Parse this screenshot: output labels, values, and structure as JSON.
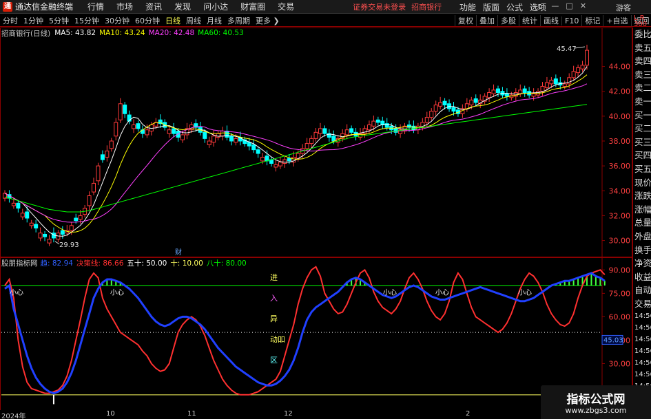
{
  "app": {
    "title": "通达信金融终端",
    "logo_glyph": "通",
    "menus": [
      "行情",
      "市场",
      "资讯",
      "发现",
      "问小达",
      "财富圈",
      "交易"
    ],
    "warning": "证券交易未登录",
    "stock_link": "招商银行",
    "right_menus": [
      "功能",
      "版面",
      "公式",
      "选项"
    ],
    "window_controls": [
      "▭",
      "—",
      "□",
      "✕"
    ],
    "guest": "游客"
  },
  "toolbar": {
    "periods": [
      "分时",
      "1分钟",
      "5分钟",
      "15分钟",
      "30分钟",
      "60分钟",
      "日线",
      "周线",
      "月线",
      "多周期",
      "更多 ❯"
    ],
    "active_period": "日线",
    "right_buttons": [
      "复权",
      "叠加",
      "多股",
      "统计",
      "画线",
      "F10",
      "标记",
      "+自选",
      "返回"
    ]
  },
  "chart": {
    "stock_name": "招商银行(日线)",
    "mas": [
      {
        "label": "MA5: 43.82",
        "color": "#ffffff"
      },
      {
        "label": "MA10: 43.24",
        "color": "#ffff00"
      },
      {
        "label": "MA20: 42.48",
        "color": "#ff40ff"
      },
      {
        "label": "MA60: 40.53",
        "color": "#00ff00"
      }
    ],
    "y_ticks": [
      "44.00",
      "42.00",
      "40.00",
      "38.00",
      "36.00",
      "34.00",
      "32.00",
      "30.00"
    ],
    "high_label": "45.47",
    "low_label": "29.93",
    "fin_marker": "财"
  },
  "indicator": {
    "name": "股朋指标网",
    "params": [
      {
        "label": "趋: 82.94",
        "color": "#3060ff"
      },
      {
        "label": "决策线: 86.66",
        "color": "#ff3030"
      },
      {
        "label": "五十: 50.00",
        "color": "#ffffff"
      },
      {
        "label": "十: 10.00",
        "color": "#ffff60"
      },
      {
        "label": "八十: 80.00",
        "color": "#00ff00"
      }
    ],
    "y_ticks": [
      "90.00",
      "75.00",
      "60.00",
      "45.00",
      "30.00"
    ],
    "current_value": "45.03",
    "caution_label": "小心",
    "vertical_text": [
      "进",
      "入",
      "异",
      "动吅",
      "区"
    ]
  },
  "side_panel": [
    "委比",
    "卖五",
    "卖四",
    "卖三",
    "卖二",
    "卖一",
    "买一",
    "买二",
    "买三",
    "买四",
    "买五",
    "现价",
    "涨跌",
    "涨幅",
    "总量",
    "外盘",
    "换手",
    "净资",
    "收益",
    "自动",
    "交易",
    "14:56",
    "14:56",
    "14:56",
    "14:56",
    "14:56",
    "14:56",
    "14:56",
    "14:56"
  ],
  "side_corner": "L R 300",
  "x_axis": [
    "2024年",
    "10",
    "11",
    "12",
    "2"
  ],
  "watermark": {
    "main": "指标公式网",
    "sub": "www.zbgs3.com"
  },
  "colors": {
    "up": "#ff3a3a",
    "down": "#00ffff",
    "frame": "#8b0000",
    "ma5": "#ffffff",
    "ma10": "#ffff00",
    "ma20": "#ff40ff",
    "ma60": "#00ff00",
    "trend_line": "#2040ff",
    "decision_line": "#ff3030",
    "line80": "#00ff00",
    "line10": "#ffff60",
    "line50": "#ffffff"
  },
  "chart_data": {
    "type": "candlestick",
    "ylim": [
      29.2,
      46.3
    ],
    "closes": [
      33.8,
      33.4,
      33.0,
      32.6,
      32.2,
      31.8,
      31.4,
      31.0,
      30.6,
      30.3,
      30.1,
      30.2,
      30.6,
      30.5,
      30.8,
      31.2,
      31.6,
      32.0,
      32.6,
      33.6,
      34.6,
      36.0,
      36.5,
      37.2,
      38.0,
      39.5,
      41.0,
      40.2,
      39.6,
      39.3,
      39.0,
      38.6,
      38.9,
      39.3,
      39.5,
      39.4,
      39.1,
      38.9,
      38.6,
      38.3,
      38.5,
      39.0,
      39.3,
      39.1,
      38.7,
      38.2,
      38.0,
      38.4,
      38.6,
      38.8,
      38.3,
      38.0,
      38.2,
      38.0,
      37.8,
      37.6,
      37.3,
      37.0,
      36.7,
      36.4,
      36.2,
      36.1,
      36.3,
      36.5,
      36.4,
      36.7,
      37.0,
      37.4,
      37.8,
      38.2,
      38.7,
      39.0,
      38.6,
      38.3,
      38.0,
      38.2,
      38.6,
      38.9,
      38.7,
      38.4,
      38.6,
      39.0,
      39.3,
      39.6,
      39.5,
      39.3,
      39.1,
      38.9,
      38.7,
      38.9,
      39.2,
      39.1,
      38.9,
      39.2,
      39.5,
      39.9,
      40.4,
      40.9,
      41.1,
      40.9,
      40.6,
      40.4,
      40.2,
      40.6,
      41.0,
      41.3,
      41.1,
      41.3,
      41.6,
      41.9,
      42.1,
      41.9,
      41.7,
      41.6,
      41.7,
      41.9,
      42.1,
      41.9,
      41.7,
      41.8,
      42.0,
      42.4,
      42.7,
      42.9,
      42.6,
      42.5,
      42.6,
      43.1,
      43.6,
      43.9,
      44.1,
      45.3
    ],
    "diffs": [
      0.4,
      -0.3,
      0.2,
      -0.4,
      0.3,
      -0.5,
      0.2,
      -0.3,
      0.4,
      -0.2,
      0.3,
      -0.4,
      0.5,
      -0.3,
      0.2,
      0.4,
      -0.2,
      0.3,
      0.5,
      0.8,
      0.7,
      1.2,
      -0.4,
      0.5,
      0.6,
      1.1,
      1.3,
      -0.7,
      -0.5,
      0.3,
      -0.4,
      -0.3,
      0.4,
      0.5,
      0.3,
      -0.3,
      -0.4,
      0.3,
      -0.4,
      -0.5,
      0.4,
      0.5,
      0.4,
      -0.3,
      -0.4,
      -0.5,
      0.3,
      0.5,
      0.3,
      0.4,
      -0.5,
      -0.4,
      0.3,
      -0.3,
      -0.3,
      -0.3,
      -0.4,
      -0.3,
      0.3,
      -0.4,
      -0.3,
      0.2,
      0.3,
      0.3,
      -0.2,
      0.4,
      0.4,
      0.4,
      0.4,
      0.4,
      0.5,
      0.4,
      -0.4,
      -0.3,
      -0.4,
      0.3,
      0.4,
      0.4,
      -0.3,
      -0.3,
      0.3,
      0.4,
      0.4,
      0.4,
      -0.2,
      -0.3,
      -0.3,
      -0.3,
      -0.3,
      0.3,
      0.4,
      -0.2,
      -0.3,
      0.3,
      0.4,
      0.4,
      0.5,
      0.5,
      0.3,
      -0.3,
      -0.4,
      -0.3,
      -0.3,
      0.4,
      0.4,
      0.4,
      -0.3,
      0.3,
      0.4,
      0.4,
      0.3,
      -0.3,
      -0.3,
      -0.2,
      0.2,
      0.3,
      0.3,
      -0.3,
      -0.3,
      0.2,
      0.3,
      0.4,
      0.4,
      0.3,
      -0.4,
      -0.2,
      0.2,
      0.5,
      0.5,
      0.4,
      0.3,
      1.2
    ],
    "ma60": [
      33.5,
      33.4,
      33.3,
      33.2,
      33.1,
      33.0,
      32.9,
      32.8,
      32.7,
      32.6,
      32.5,
      32.45,
      32.4,
      32.35,
      32.3,
      32.3,
      32.3,
      32.3,
      32.35,
      32.4,
      32.5,
      32.6,
      32.7,
      32.8,
      32.9,
      33.0,
      33.1,
      33.2,
      33.3,
      33.4,
      33.5,
      33.6,
      33.7,
      33.8,
      33.9,
      34.0,
      34.1,
      34.2,
      34.3,
      34.4,
      34.5,
      34.6,
      34.7,
      34.8,
      34.9,
      35.0,
      35.1,
      35.2,
      35.3,
      35.4,
      35.5,
      35.6,
      35.7,
      35.8,
      35.9,
      36.0,
      36.1,
      36.2,
      36.3,
      36.4,
      36.5,
      36.6,
      36.7,
      36.8,
      36.9,
      37.0,
      37.1,
      37.2,
      37.3,
      37.4,
      37.5,
      37.6,
      37.7,
      37.8,
      37.9,
      38.0,
      38.1,
      38.2,
      38.3,
      38.35,
      38.4,
      38.45,
      38.5,
      38.55,
      38.6,
      38.65,
      38.7,
      38.75,
      38.8,
      38.85,
      38.9,
      38.95,
      39.0,
      39.05,
      39.1,
      39.15,
      39.2,
      39.25,
      39.3,
      39.35,
      39.4,
      39.45,
      39.5,
      39.55,
      39.6,
      39.65,
      39.7,
      39.75,
      39.8,
      39.85,
      39.9,
      39.95,
      40.0,
      40.05,
      40.1,
      40.15,
      40.2,
      40.25,
      40.3,
      40.35,
      40.4,
      40.45,
      40.5,
      40.55,
      40.6,
      40.65,
      40.7,
      40.75,
      40.8,
      40.85,
      40.9,
      40.95,
      41.0,
      40.53
    ],
    "trend": [
      78,
      80,
      65,
      55,
      45,
      35,
      27,
      21,
      17,
      14,
      12,
      11,
      12,
      14,
      18,
      24,
      32,
      42,
      52,
      62,
      72,
      78,
      82,
      84,
      84,
      83,
      82,
      80,
      78,
      75,
      72,
      68,
      64,
      60,
      57,
      55,
      54,
      55,
      57,
      59,
      60,
      60,
      59,
      57,
      55,
      52,
      48,
      44,
      40,
      37,
      34,
      31,
      28,
      26,
      24,
      22,
      20,
      18,
      17,
      16,
      16,
      17,
      19,
      22,
      26,
      32,
      40,
      50,
      58,
      63,
      66,
      68,
      70,
      72,
      74,
      76,
      79,
      82,
      84,
      85,
      84,
      82,
      80,
      78,
      76,
      74,
      73,
      72,
      73,
      75,
      77,
      79,
      80,
      79,
      77,
      75,
      73,
      72,
      71,
      71,
      72,
      73,
      74,
      75,
      76,
      77,
      78,
      79,
      78,
      77,
      76,
      75,
      74,
      73,
      72,
      71,
      70,
      70,
      71,
      72,
      74,
      76,
      78,
      80,
      81,
      82,
      83,
      83,
      84,
      85,
      86,
      87,
      88,
      86,
      85,
      83
    ],
    "decision": [
      80,
      84,
      72,
      45,
      28,
      18,
      14,
      13,
      12,
      11,
      11,
      12,
      13,
      16,
      22,
      32,
      45,
      58,
      72,
      84,
      88,
      85,
      72,
      65,
      60,
      55,
      50,
      48,
      46,
      44,
      42,
      38,
      35,
      30,
      27,
      25,
      26,
      30,
      40,
      50,
      55,
      58,
      60,
      58,
      54,
      48,
      40,
      32,
      26,
      20,
      16,
      13,
      11,
      10,
      10,
      10,
      11,
      12,
      14,
      16,
      18,
      20,
      25,
      35,
      45,
      55,
      68,
      78,
      85,
      90,
      92,
      86,
      75,
      70,
      65,
      62,
      63,
      68,
      75,
      82,
      88,
      90,
      85,
      76,
      70,
      66,
      64,
      62,
      65,
      70,
      78,
      85,
      88,
      84,
      78,
      70,
      64,
      60,
      58,
      62,
      70,
      82,
      88,
      84,
      75,
      66,
      60,
      58,
      56,
      54,
      52,
      50,
      52,
      56,
      62,
      70,
      78,
      84,
      88,
      86,
      82,
      76,
      68,
      62,
      58,
      55,
      54,
      56,
      62,
      72,
      80,
      86,
      88,
      89,
      90,
      87
    ]
  }
}
